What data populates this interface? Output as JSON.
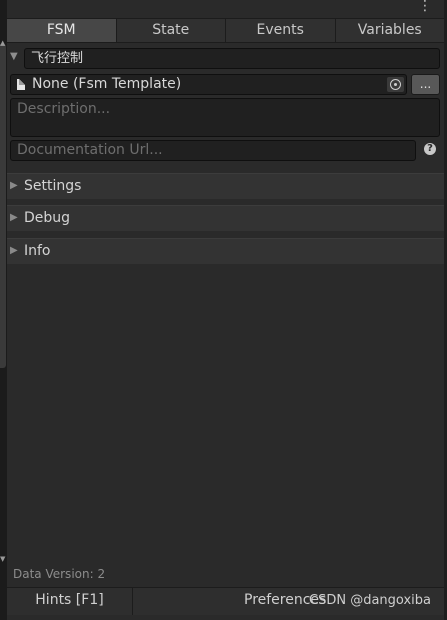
{
  "tabs": [
    "FSM",
    "State",
    "Events",
    "Variables"
  ],
  "active_tab": "FSM",
  "fsm": {
    "name": "飞行控制",
    "template_value": "None (Fsm Template)",
    "browse_label": "...",
    "description_placeholder": "Description...",
    "doc_url_placeholder": "Documentation Url...",
    "help_glyph": "?"
  },
  "sections": [
    "Settings",
    "Debug",
    "Info"
  ],
  "footer": {
    "data_version": "Data Version: 2",
    "hints_label": "Hints [F1]",
    "preferences_label": "Preferences",
    "watermark": "CSDN @dangoxiba"
  },
  "icons": {
    "menu": "kebab-menu-icon",
    "foldout": "triangle-right-icon",
    "expanded": "triangle-down-icon",
    "document": "document-icon",
    "picker": "object-picker-icon",
    "help": "help-icon"
  }
}
